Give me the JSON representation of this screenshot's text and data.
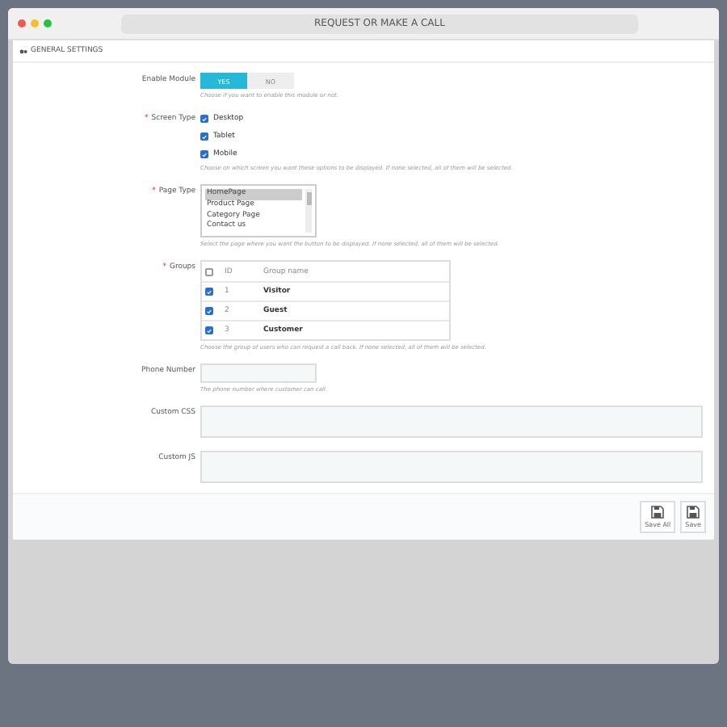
{
  "window": {
    "title": "REQUEST OR MAKE A CALL"
  },
  "panel": {
    "title": "GENERAL SETTINGS"
  },
  "enable_module": {
    "label": "Enable Module",
    "options": [
      {
        "label": "YES",
        "selected": true
      },
      {
        "label": "NO",
        "selected": false
      }
    ],
    "help": "Choose if you want to enable this module or not."
  },
  "screen_type": {
    "label": "Screen Type",
    "required_mark": "*",
    "options": [
      {
        "label": "Desktop",
        "checked": true
      },
      {
        "label": "Tablet",
        "checked": true
      },
      {
        "label": "Mobile",
        "checked": true
      }
    ],
    "help": "Choose on which screen you want these options to be displayed. If none selected, all of them will be selected."
  },
  "page_type": {
    "label": "Page Type",
    "required_mark": "*",
    "options": [
      {
        "label": "HomePage",
        "selected": true
      },
      {
        "label": "Product Page",
        "selected": false
      },
      {
        "label": "Category Page",
        "selected": false
      },
      {
        "label": "Contact us",
        "selected": false
      }
    ],
    "help": "Select the page where you want the button to be displayed. If none selected, all of them will be selected."
  },
  "groups": {
    "label": "Groups",
    "required_mark": "*",
    "all_checked": false,
    "columns": [
      "ID",
      "Group name"
    ],
    "rows": [
      {
        "checked": true,
        "id": "1",
        "name": "Visitor"
      },
      {
        "checked": true,
        "id": "2",
        "name": "Guest"
      },
      {
        "checked": true,
        "id": "3",
        "name": "Customer"
      }
    ],
    "help": "Choose the group of users who can request a call back. If none selected, all of them will be selected."
  },
  "phone": {
    "label": "Phone Number",
    "help": "The phone number where customer can call."
  },
  "custom_css": {
    "label": "Custom CSS"
  },
  "custom_js": {
    "label": "Custom JS"
  },
  "buttons": [
    {
      "label": "Save All"
    },
    {
      "label": "Save"
    }
  ]
}
